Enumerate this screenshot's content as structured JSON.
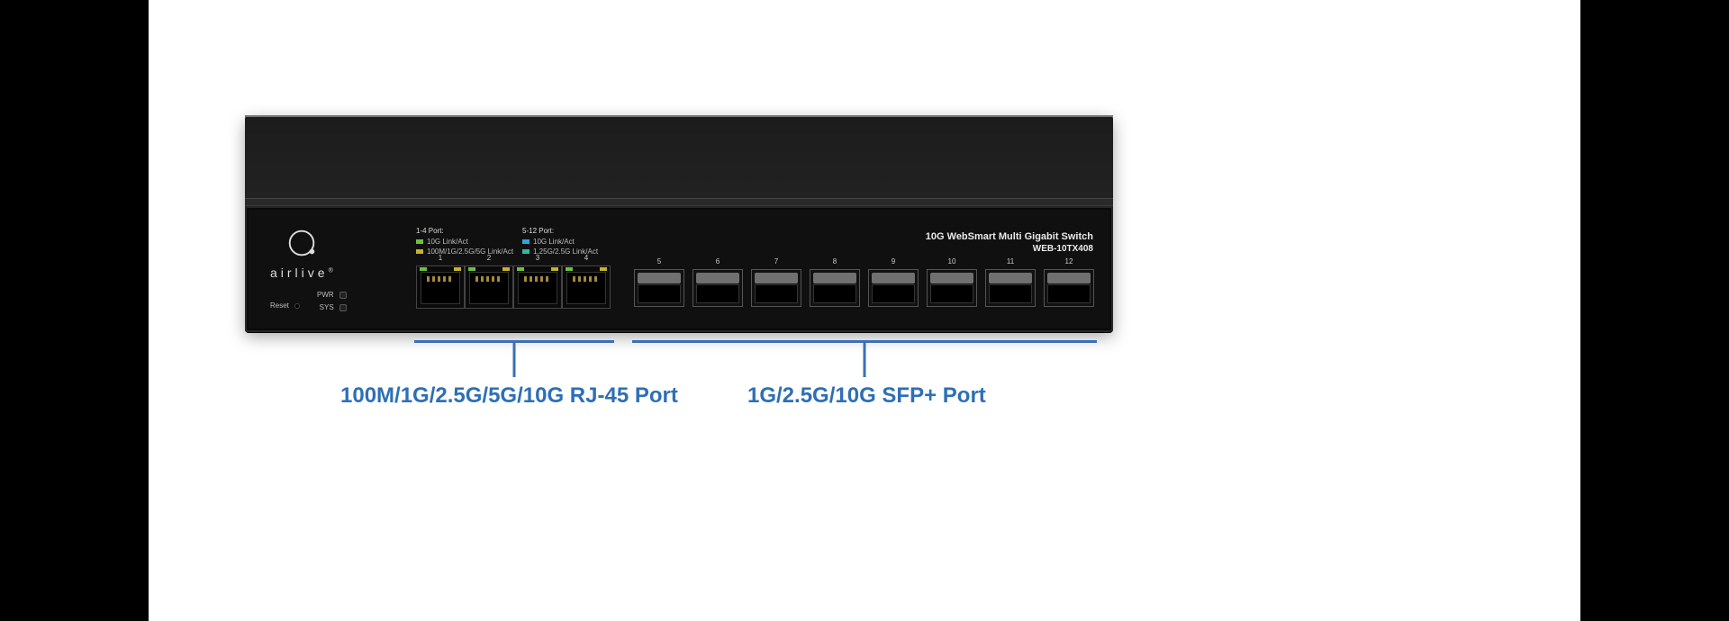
{
  "brand": {
    "name": "airlive",
    "tm": "®"
  },
  "status": {
    "reset": "Reset",
    "pwr": "PWR",
    "sys": "SYS"
  },
  "legend": {
    "left": {
      "header": "1-4 Port:",
      "row1": "10G Link/Act",
      "row2": "100M/1G/2.5G/5G Link/Act"
    },
    "right": {
      "header": "5-12 Port:",
      "row1": "10G Link/Act",
      "row2": "1.25G/2.5G Link/Act"
    }
  },
  "title": {
    "line1": "10G WebSmart Multi Gigabit Switch",
    "line2": "WEB-10TX408"
  },
  "ports": {
    "rj45": [
      "1",
      "2",
      "3",
      "4"
    ],
    "sfp": [
      "5",
      "6",
      "7",
      "8",
      "9",
      "10",
      "11",
      "12"
    ]
  },
  "annotations": {
    "rj45": "100M/1G/2.5G/5G/10G RJ-45 Port",
    "sfp": "1G/2.5G/10G SFP+ Port"
  }
}
